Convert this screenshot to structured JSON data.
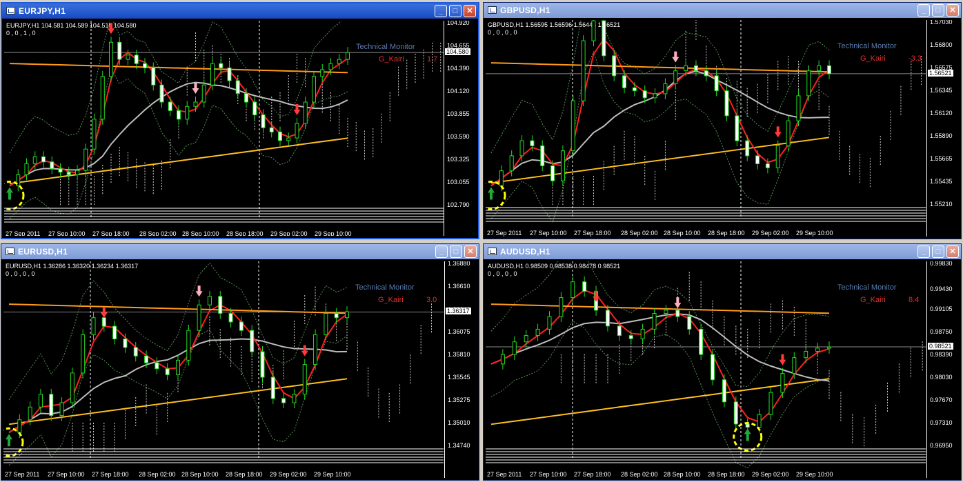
{
  "windows": [
    {
      "id": "eurjpy",
      "title": "EURJPY,H1",
      "header": "EURJPY,H1  104.581 104.589 104.515 104.580",
      "subheader": "0 , 0 , 1 , 0",
      "monitor": "Technical  Monitor",
      "kairi_label": "G_Kairi",
      "kairi_value": "1.7",
      "price_ticks": [
        "104.920",
        "104.655",
        "104.390",
        "104.120",
        "103.855",
        "103.590",
        "103.325",
        "103.055",
        "102.790"
      ],
      "current_price": "104.580",
      "time_ticks": [
        "27 Sep 2011",
        "27 Sep 10:00",
        "27 Sep 18:00",
        "28 Sep 02:00",
        "28 Sep 10:00",
        "28 Sep 18:00",
        "29 Sep 02:00",
        "29 Sep 10:00"
      ],
      "closes": [
        103.02,
        103.15,
        103.28,
        103.36,
        103.3,
        103.22,
        103.18,
        103.15,
        103.2,
        103.45,
        103.8,
        104.3,
        104.7,
        104.5,
        104.55,
        104.45,
        104.4,
        104.2,
        104.0,
        103.9,
        103.8,
        103.95,
        104.0,
        104.2,
        104.45,
        104.4,
        104.25,
        104.1,
        104.0,
        103.85,
        103.7,
        103.65,
        103.55,
        103.58,
        103.75,
        104.0,
        104.3,
        104.38,
        104.45,
        104.5,
        104.58
      ],
      "colors": {
        "accent": "#1e5adc"
      }
    },
    {
      "id": "gbpusd",
      "title": "GBPUSD,H1",
      "header": "GBPUSD,H1  1.56595 1.56596 1.56446 1.56521",
      "subheader": "0 , 0 , 0 , 0",
      "monitor": "Technical  Monitor",
      "kairi_label": "G_Kairi",
      "kairi_value": "-3.3",
      "price_ticks": [
        "1.57030",
        "1.56800",
        "1.56575",
        "1.56345",
        "1.56120",
        "1.55890",
        "1.55665",
        "1.55435",
        "1.55210"
      ],
      "current_price": "1.56521",
      "time_ticks": [
        "27 Sep 2011",
        "27 Sep 10:00",
        "27 Sep 18:00",
        "28 Sep 02:00",
        "28 Sep 10:00",
        "28 Sep 18:00",
        "29 Sep 02:00",
        "29 Sep 10:00"
      ],
      "closes": [
        1.554,
        1.5555,
        1.557,
        1.5585,
        1.558,
        1.556,
        1.5545,
        1.5575,
        1.5625,
        1.5685,
        1.5705,
        1.567,
        1.565,
        1.5638,
        1.5635,
        1.5628,
        1.5632,
        1.5642,
        1.5655,
        1.566,
        1.5655,
        1.565,
        1.5635,
        1.561,
        1.5585,
        1.557,
        1.5562,
        1.5558,
        1.558,
        1.5605,
        1.563,
        1.5655,
        1.566,
        1.5652
      ],
      "colors": {
        "accent": "#7d9ad6"
      }
    },
    {
      "id": "eurusd",
      "title": "EURUSD,H1",
      "header": "EURUSD,H1  1.36286 1.36320 1.36234 1.36317",
      "subheader": "0 , 0 , 0 , 0",
      "monitor": "Technical  Monitor",
      "kairi_label": "G_Kairi",
      "kairi_value": "3.0",
      "price_ticks": [
        "1.36880",
        "1.36610",
        "1.36340",
        "1.36075",
        "1.35810",
        "1.35545",
        "1.35275",
        "1.35010",
        "1.34740"
      ],
      "current_price": "1.36317",
      "time_ticks": [
        "27 Sep 2011",
        "27 Sep 10:00",
        "27 Sep 18:00",
        "28 Sep 02:00",
        "28 Sep 10:00",
        "28 Sep 18:00",
        "29 Sep 02:00",
        "29 Sep 10:00"
      ],
      "closes": [
        1.349,
        1.3505,
        1.352,
        1.3535,
        1.351,
        1.3525,
        1.356,
        1.3605,
        1.3625,
        1.3615,
        1.36,
        1.359,
        1.358,
        1.3572,
        1.3565,
        1.3558,
        1.3575,
        1.361,
        1.364,
        1.365,
        1.363,
        1.362,
        1.361,
        1.3585,
        1.3555,
        1.353,
        1.3525,
        1.3535,
        1.357,
        1.3605,
        1.363,
        1.3625,
        1.3632
      ],
      "colors": {
        "accent": "#7d9ad6"
      }
    },
    {
      "id": "audusd",
      "title": "AUDUSD,H1",
      "header": "AUDUSD,H1  0.98509 0.98538 0.98478 0.98521",
      "subheader": "0 , 0 , 0 , 0",
      "monitor": "Technical  Monitor",
      "kairi_label": "G_Kairi",
      "kairi_value": "8.4",
      "price_ticks": [
        "0.99830",
        "0.99430",
        "0.99105",
        "0.98750",
        "0.98390",
        "0.98030",
        "0.97670",
        "0.97310",
        "0.96950"
      ],
      "current_price": "0.98521",
      "time_ticks": [
        "27 Sep 2011",
        "27 Sep 10:00",
        "27 Sep 18:00",
        "28 Sep 02:00",
        "28 Sep 10:00",
        "28 Sep 18:00",
        "29 Sep 02:00",
        "29 Sep 10:00"
      ],
      "closes": [
        0.9825,
        0.984,
        0.986,
        0.987,
        0.988,
        0.99,
        0.993,
        0.9955,
        0.994,
        0.991,
        0.9885,
        0.987,
        0.9865,
        0.988,
        0.9905,
        0.991,
        0.99,
        0.988,
        0.984,
        0.98,
        0.9765,
        0.973,
        0.9725,
        0.9745,
        0.978,
        0.981,
        0.9835,
        0.9845,
        0.985,
        0.9852
      ],
      "colors": {
        "accent": "#7d9ad6"
      }
    }
  ]
}
